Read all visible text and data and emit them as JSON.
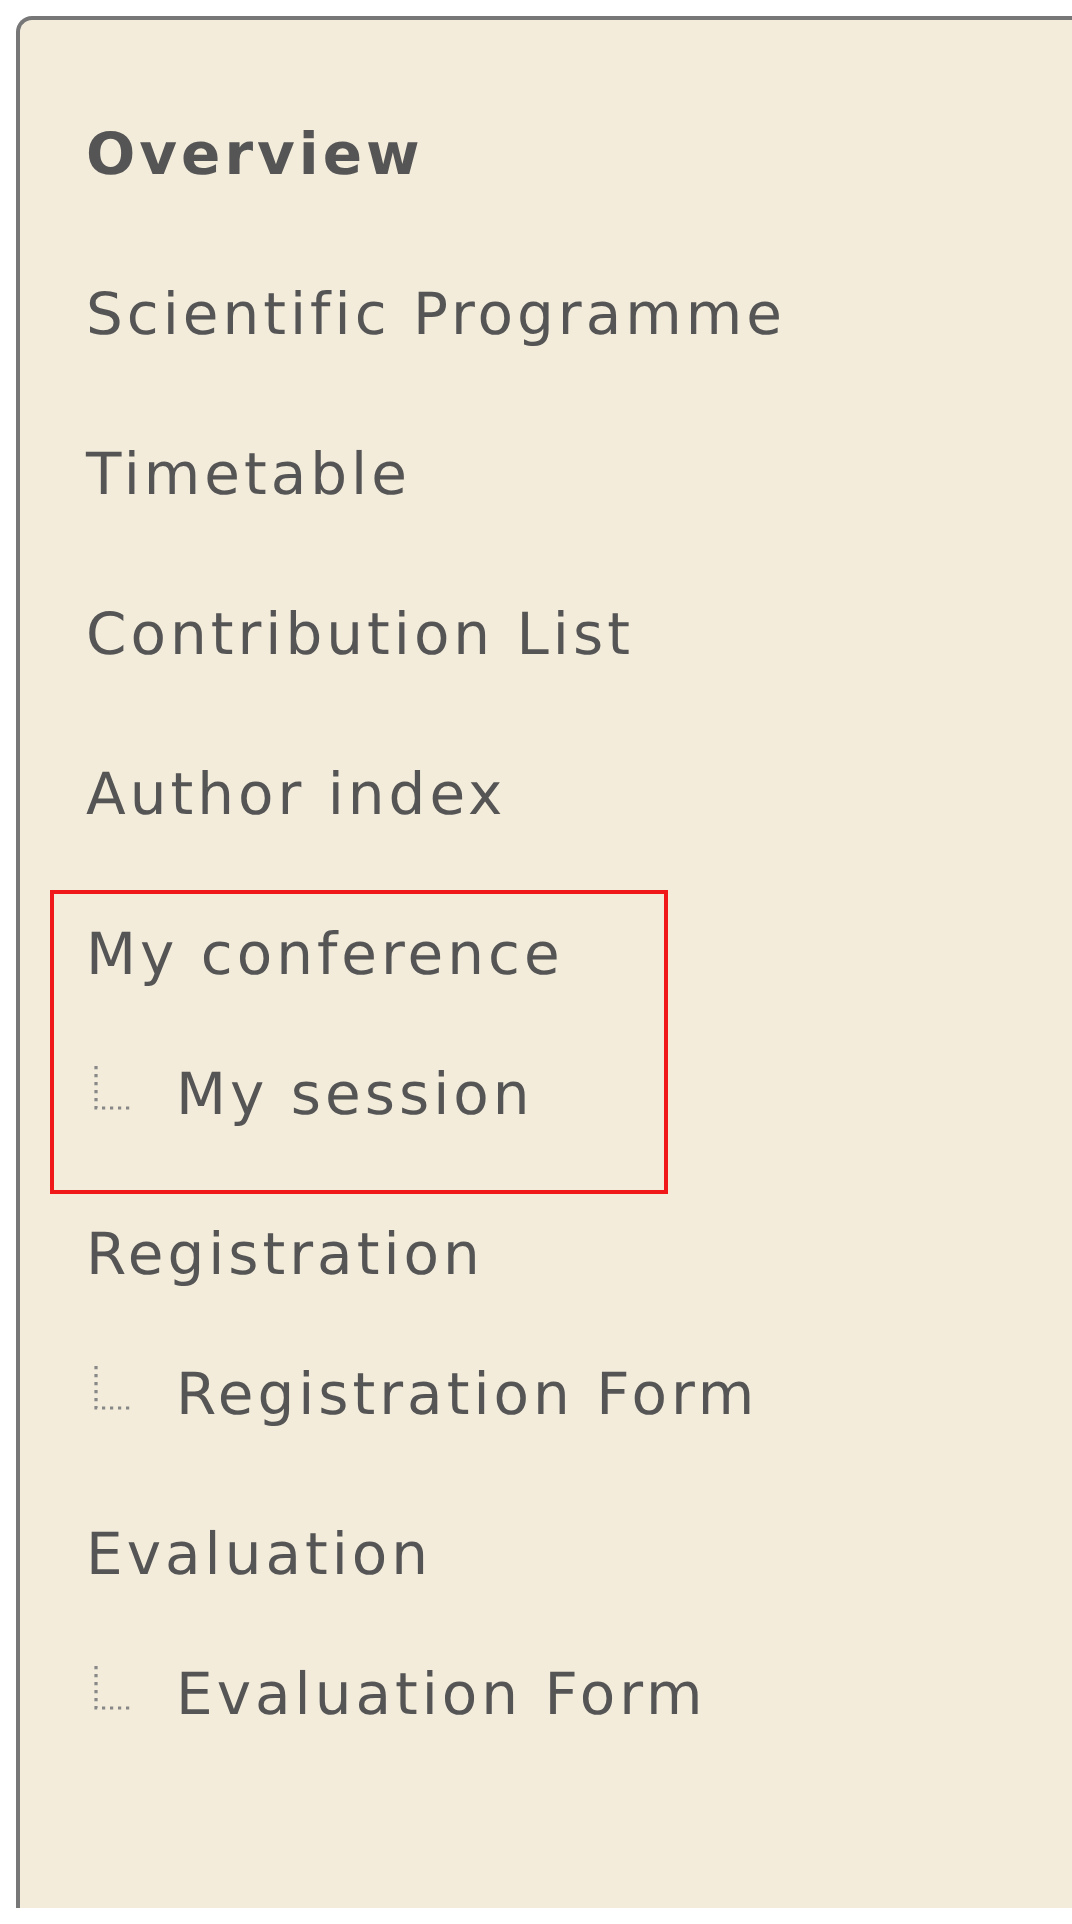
{
  "menu": {
    "items": [
      {
        "label": "Overview",
        "selected": true,
        "highlighted": false
      },
      {
        "label": "Scientific Programme",
        "selected": false,
        "highlighted": false
      },
      {
        "label": "Timetable",
        "selected": false,
        "highlighted": false
      },
      {
        "label": "Contribution List",
        "selected": false,
        "highlighted": false
      },
      {
        "label": "Author index",
        "selected": false,
        "highlighted": false
      },
      {
        "label": "My conference",
        "selected": false,
        "highlighted": true,
        "children": [
          {
            "label": "My session",
            "selected": false
          }
        ]
      },
      {
        "label": "Registration",
        "selected": false,
        "highlighted": false,
        "children": [
          {
            "label": "Registration Form",
            "selected": false
          }
        ]
      },
      {
        "label": "Evaluation",
        "selected": false,
        "highlighted": false,
        "children": [
          {
            "label": "Evaluation Form",
            "selected": false
          }
        ]
      }
    ]
  }
}
